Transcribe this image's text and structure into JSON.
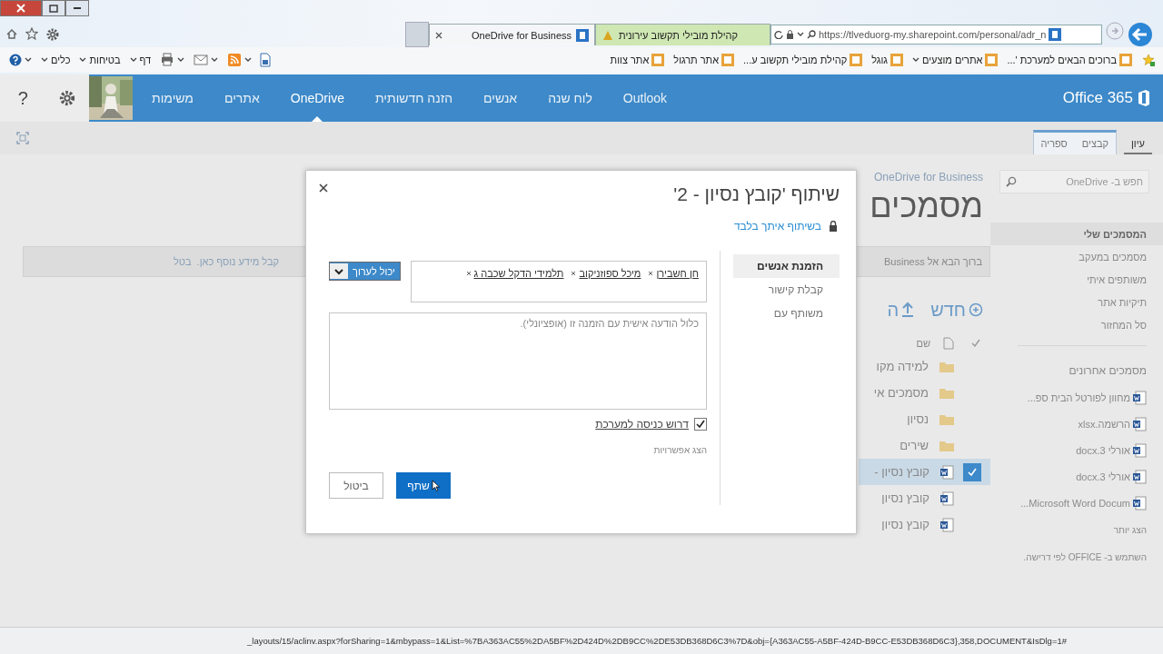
{
  "browser": {
    "tabs": [
      {
        "label": "קהילת מובילי תקשוב עירונית",
        "selected": false
      },
      {
        "label": "OneDrive for Business",
        "selected": true
      }
    ],
    "address": "https://tlveduorg-my.sharepoint.com/personal/adr_n",
    "commands": [
      {
        "label": "דף"
      },
      {
        "label": "בטיחות"
      },
      {
        "label": "כלים"
      }
    ],
    "favorites": [
      {
        "label": "ברוכים הבאים למערכת '...",
        "kind": "link"
      },
      {
        "label": "אתרים מוצעים",
        "kind": "menu"
      },
      {
        "label": "גוגל",
        "kind": "link"
      },
      {
        "label": "קהילת מובילי תקשוב ע...",
        "kind": "link"
      },
      {
        "label": "אתר תרגול",
        "kind": "link"
      },
      {
        "label": "אתר צוות",
        "kind": "link"
      }
    ]
  },
  "suite_bar": {
    "help": "?",
    "brand": "Office 365",
    "links": [
      {
        "label": "Outlook",
        "selected": false
      },
      {
        "label": "לוח שנה",
        "selected": false
      },
      {
        "label": "אנשים",
        "selected": false
      },
      {
        "label": "הזנה חדשותית",
        "selected": false
      },
      {
        "label": "OneDrive",
        "selected": true
      },
      {
        "label": "אתרים",
        "selected": false
      },
      {
        "label": "משימות",
        "selected": false
      }
    ]
  },
  "ribbon_tabs": [
    {
      "label": "עיון",
      "kind": "main",
      "selected": true
    },
    {
      "label": "קבצים",
      "kind": "contextual",
      "selected": false
    },
    {
      "label": "ספריה",
      "kind": "contextual",
      "selected": false
    }
  ],
  "sidebar": {
    "search_placeholder": "חפש ב- OneDrive",
    "items": [
      {
        "label": "המסמכים שלי",
        "selected": true
      },
      {
        "label": "מסמכים במעקב",
        "selected": false
      },
      {
        "label": "משותפים איתי",
        "selected": false
      },
      {
        "label": "תיקיות אתר",
        "selected": false
      },
      {
        "label": "סל המחזור",
        "selected": false
      }
    ],
    "recent_heading": "מסמכים אחרונים",
    "recent": [
      "מחוון לפורטל הבית ספ...",
      "הרשמה.xlsx",
      "אורלי 3.docx",
      "אורלי 3.docx",
      "Microsoft Word Docum..."
    ],
    "show_more": "הצג יותר",
    "footer": "השתמש ב- OFFICE לפי דרישה."
  },
  "main": {
    "breadcrumb": "OneDrive for Business",
    "title": "מסמכים",
    "banner": {
      "text": "ברוך הבא אל Business",
      "link": "קבל מידע נוסף כאן.",
      "dismiss": "בטל"
    },
    "new_label": "חדש",
    "upload_label": "ה",
    "name_column": "שם",
    "rows": [
      {
        "name": "למידה מקו",
        "kind": "folder",
        "selected": false
      },
      {
        "name": "מסמכים אי",
        "kind": "folder",
        "selected": false
      },
      {
        "name": "נסיון",
        "kind": "folder",
        "selected": false
      },
      {
        "name": "שירים",
        "kind": "folder",
        "selected": false
      },
      {
        "name": "קובץ נסיון -",
        "kind": "file",
        "selected": true
      },
      {
        "name": "קובץ נסיון",
        "kind": "file",
        "selected": false
      },
      {
        "name": "קובץ נסיון",
        "kind": "file",
        "selected": false
      }
    ]
  },
  "dialog": {
    "title": "שיתוף 'קובץ נסיון - 2'",
    "access": "בשיתוף איתך בלבד",
    "nav": [
      {
        "label": "הזמנת אנשים",
        "selected": true
      },
      {
        "label": "קבלת קישור",
        "selected": false
      },
      {
        "label": "משותף עם",
        "selected": false
      }
    ],
    "people": [
      "חן חשבירן",
      "מיכל ספוזניקוב",
      "תלמידי הדקל שכבה ג"
    ],
    "permission": "יכול לערוך",
    "message_placeholder": "כלול הודעה אישית עם הזמנה זו (אופציונלי).",
    "require_signin": {
      "label": "דרוש כניסה למערכת",
      "checked": true
    },
    "show_options": "הצג אפשרויות",
    "buttons": [
      {
        "label": "שתף",
        "kind": "primary"
      },
      {
        "label": "ביטול",
        "kind": "secondary"
      }
    ]
  },
  "status_bar": "_layouts/15/aclinv.aspx?forSharing=1&mbypass=1&List=%7BA363AC55%2DA5BF%2D424D%2DB9CC%2DE53DB368D6C3%7D&obj={A363AC55-A5BF-424D-B9CC-E53DB368D6C3},358,DOCUMENT&IsDlg=1#"
}
